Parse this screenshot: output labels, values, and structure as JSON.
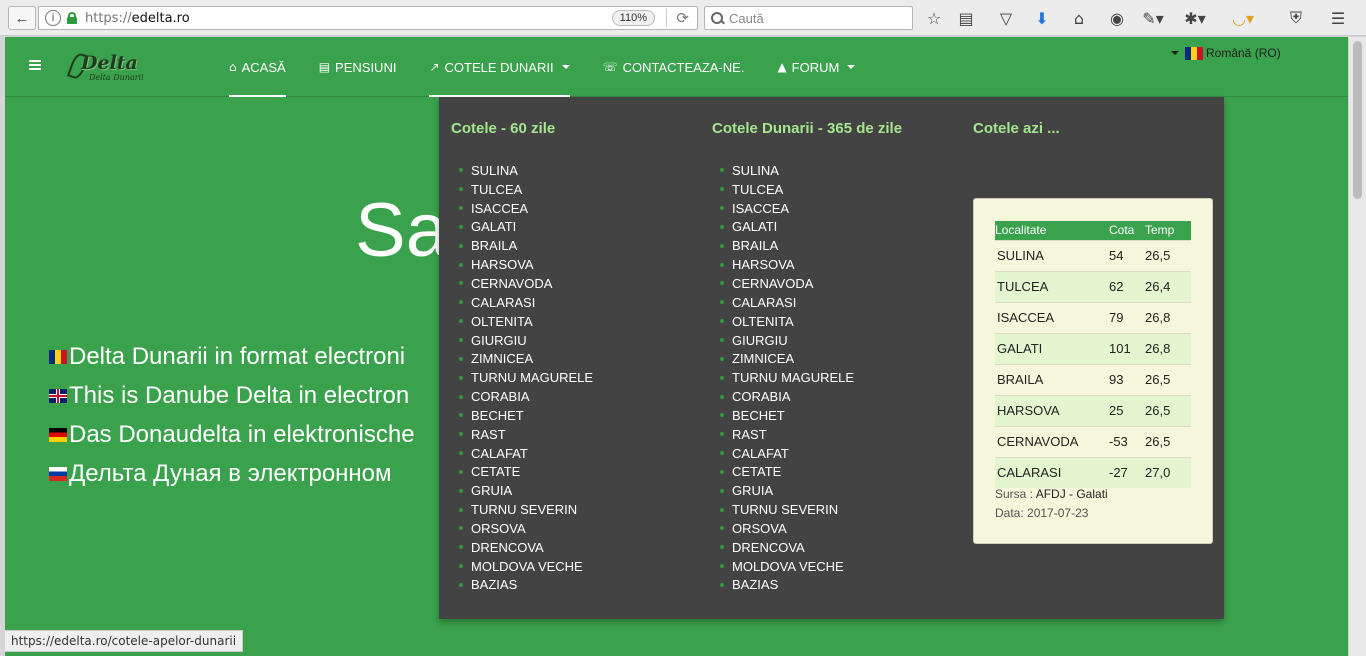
{
  "browser": {
    "url_prefix": "https://",
    "url_domain": "edelta.ro",
    "zoom": "110%",
    "search_placeholder": "Caută",
    "status_url": "https://edelta.ro/cotele-apelor-dunarii"
  },
  "nav": {
    "items": [
      {
        "label": "ACASĂ",
        "icon": "home-icon"
      },
      {
        "label": "PENSIUNI",
        "icon": "bed-icon"
      },
      {
        "label": "COTELE DUNARII",
        "icon": "chart-line-icon"
      },
      {
        "label": "CONTACTEAZA-NE.",
        "icon": "phone-icon"
      },
      {
        "label": "FORUM",
        "icon": "graduation-cap-icon"
      }
    ],
    "language": "Română (RO)"
  },
  "logo": {
    "text": "Delta",
    "subtext": "Delta Dunarii"
  },
  "hero": {
    "title": "Sa",
    "lines": [
      "Delta Dunarii in format electroni",
      "This is Danube Delta in electron",
      "Das Donaudelta in elektronische",
      "Дельта Дуная в электронном"
    ]
  },
  "dropdown": {
    "col1_title": "Cotele - 60 zile",
    "col2_title": "Cotele Dunarii - 365 de zile",
    "col3_title": "Cotele azi ...",
    "stations": [
      "SULINA",
      "TULCEA",
      "ISACCEA",
      "GALATI",
      "BRAILA",
      "HARSOVA",
      "CERNAVODA",
      "CALARASI",
      "OLTENITA",
      "GIURGIU",
      "ZIMNICEA",
      "TURNU MAGURELE",
      "CORABIA",
      "BECHET",
      "RAST",
      "CALAFAT",
      "CETATE",
      "GRUIA",
      "TURNU SEVERIN",
      "ORSOVA",
      "DRENCOVA",
      "MOLDOVA VECHE",
      "BAZIAS"
    ],
    "table": {
      "headers": [
        "Localitate",
        "Cota",
        "Temp"
      ],
      "rows": [
        [
          "SULINA",
          "54",
          "26,5"
        ],
        [
          "TULCEA",
          "62",
          "26,4"
        ],
        [
          "ISACCEA",
          "79",
          "26,8"
        ],
        [
          "GALATI",
          "101",
          "26,8"
        ],
        [
          "BRAILA",
          "93",
          "26,5"
        ],
        [
          "HARSOVA",
          "25",
          "26,5"
        ],
        [
          "CERNAVODA",
          "-53",
          "26,5"
        ],
        [
          "CALARASI",
          "-27",
          "27,0"
        ]
      ]
    },
    "source_label": "Sursa :",
    "source_value": "AFDJ - Galati",
    "date_label": "Data:",
    "date_value": "2017-07-23"
  }
}
